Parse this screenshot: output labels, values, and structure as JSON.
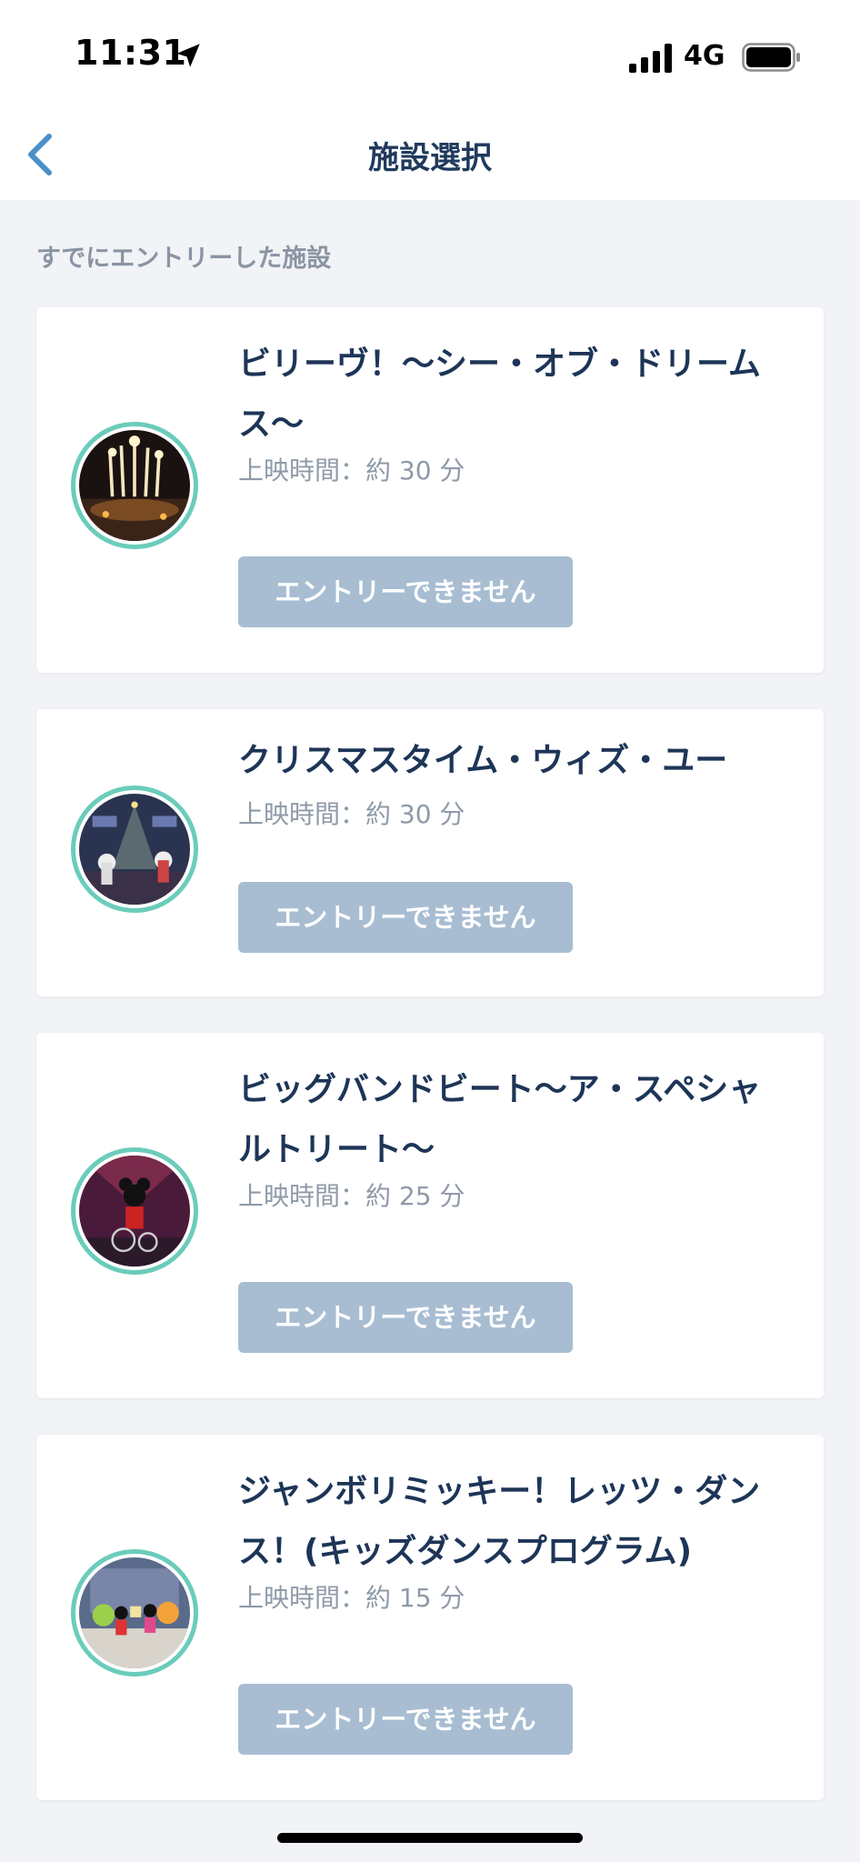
{
  "status_bar": {
    "time": "11:31",
    "network": "4G",
    "location_icon": "location-arrow-icon",
    "signal_icon": "signal-bars-icon",
    "battery_icon": "battery-icon"
  },
  "nav": {
    "title": "施設選択",
    "back_icon": "chevron-left-icon",
    "back_color": "#4a90c8"
  },
  "section_label": "すでにエントリーした施設",
  "colors": {
    "ring": "#6bccbb",
    "button_disabled": "#a8bdd2",
    "title": "#1d3557"
  },
  "cards": [
    {
      "title": "ビリーヴ！〜シー・オブ・ドリームス〜",
      "duration": "上映時間：約 30 分",
      "button_label": "エントリーできません",
      "thumb_icon": "fireworks-show-thumbnail"
    },
    {
      "title": "クリスマスタイム・ウィズ・ユー",
      "duration": "上映時間：約 30 分",
      "button_label": "エントリーできません",
      "thumb_icon": "christmas-stage-thumbnail"
    },
    {
      "title": "ビッグバンドビート〜ア・スペシャルトリート〜",
      "duration": "上映時間：約 25 分",
      "button_label": "エントリーできません",
      "thumb_icon": "big-band-stage-thumbnail"
    },
    {
      "title": "ジャンボリミッキー！レッツ・ダンス！(キッズダンスプログラム)",
      "duration": "上映時間：約 15 分",
      "button_label": "エントリーできません",
      "thumb_icon": "kids-dance-stage-thumbnail"
    }
  ]
}
